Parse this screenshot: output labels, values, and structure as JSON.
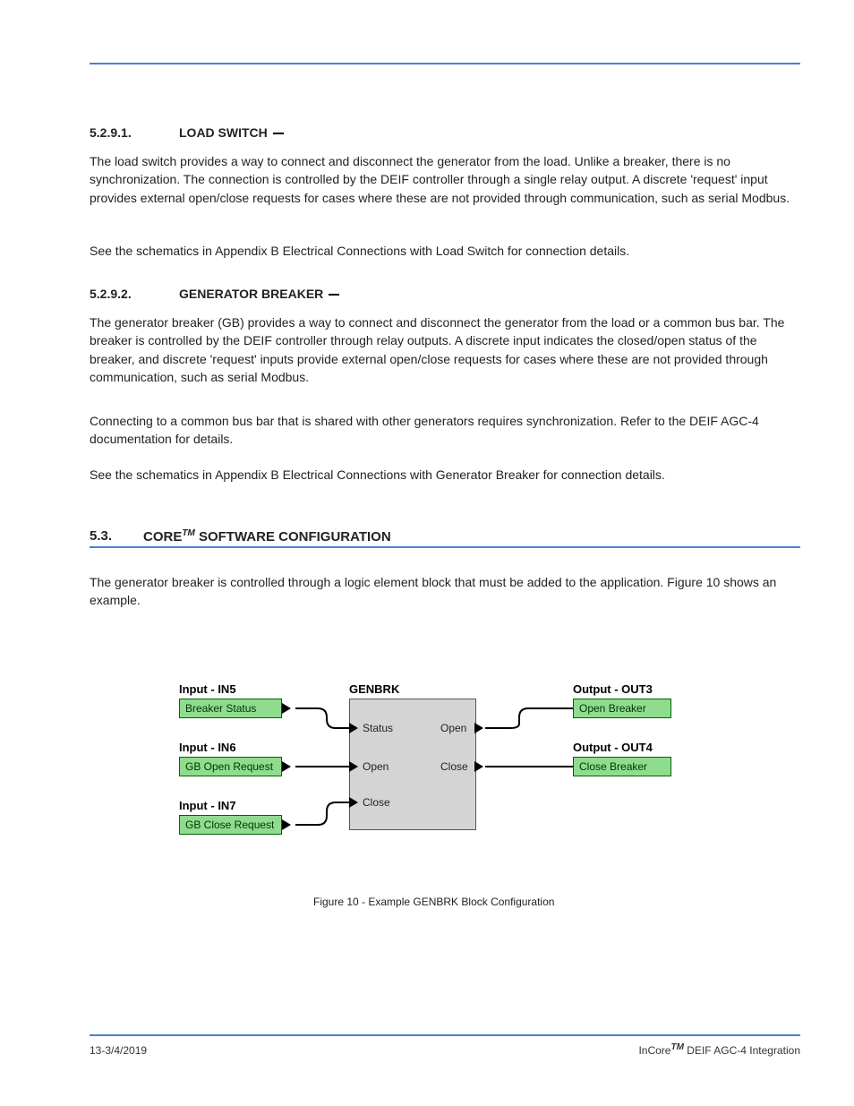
{
  "page": {
    "section_number_1": "5.2.9.1.",
    "section_title_1": "LOAD SWITCH",
    "para1a": "The load switch provides a way to connect and disconnect the generator from the load. Unlike a breaker, there is no synchronization. The connection is controlled by the DEIF controller through a single relay output. A discrete 'request' input provides external open/close requests for cases where these are not provided through communication, such as serial Modbus.",
    "para1b": "See the schematics in Appendix B ",
    "para1b_link": "Electrical Connections with Load Switch",
    "para1b_tail": " for connection details.",
    "section_number_2": "5.2.9.2.",
    "section_title_2": "GENERATOR BREAKER",
    "para2a": "The generator breaker (GB) provides a way to connect and disconnect the generator from the load or a common bus bar. The breaker is controlled by the DEIF controller through relay outputs. A discrete input indicates the closed/open status of the breaker, and discrete 'request' inputs provide external open/close requests for cases where these are not provided through communication, such as serial Modbus.",
    "para2b": "Connecting to a common bus bar that is shared with other generators requires synchronization. Refer to the DEIF AGC-4 documentation for details.",
    "para2c": "See the schematics in Appendix B ",
    "para2c_link": "Electrical Connections with Generator Breaker",
    "para2c_tail": " for connection details.",
    "section_number_3": "5.3.",
    "section_title_3_pre": "CORE",
    "section_title_3_post": " SOFTWARE CONFIGURATION",
    "para3": "The generator breaker is controlled through a logic element block that must be added to the application. Figure 10 shows an example.",
    "fig_caption": "Figure 10 - Example GENBRK Block Configuration",
    "footer_left": "13-3/4/2019",
    "footer_right_pre": "InCore",
    "footer_right_post": " DEIF AGC-4 Integration"
  },
  "diagram": {
    "in5_title": "Input - IN5",
    "in5_box": "Breaker Status",
    "in6_title": "Input - IN6",
    "in6_box": "GB Open Request",
    "in7_title": "Input - IN7",
    "in7_box": "GB Close Request",
    "gen_title": "GENBRK",
    "port_status": "Status",
    "port_open_in": "Open",
    "port_close_in": "Close",
    "port_open_out": "Open",
    "port_close_out": "Close",
    "out3_title": "Output - OUT3",
    "out3_box": "Open Breaker",
    "out4_title": "Output - OUT4",
    "out4_box": "Close Breaker"
  }
}
